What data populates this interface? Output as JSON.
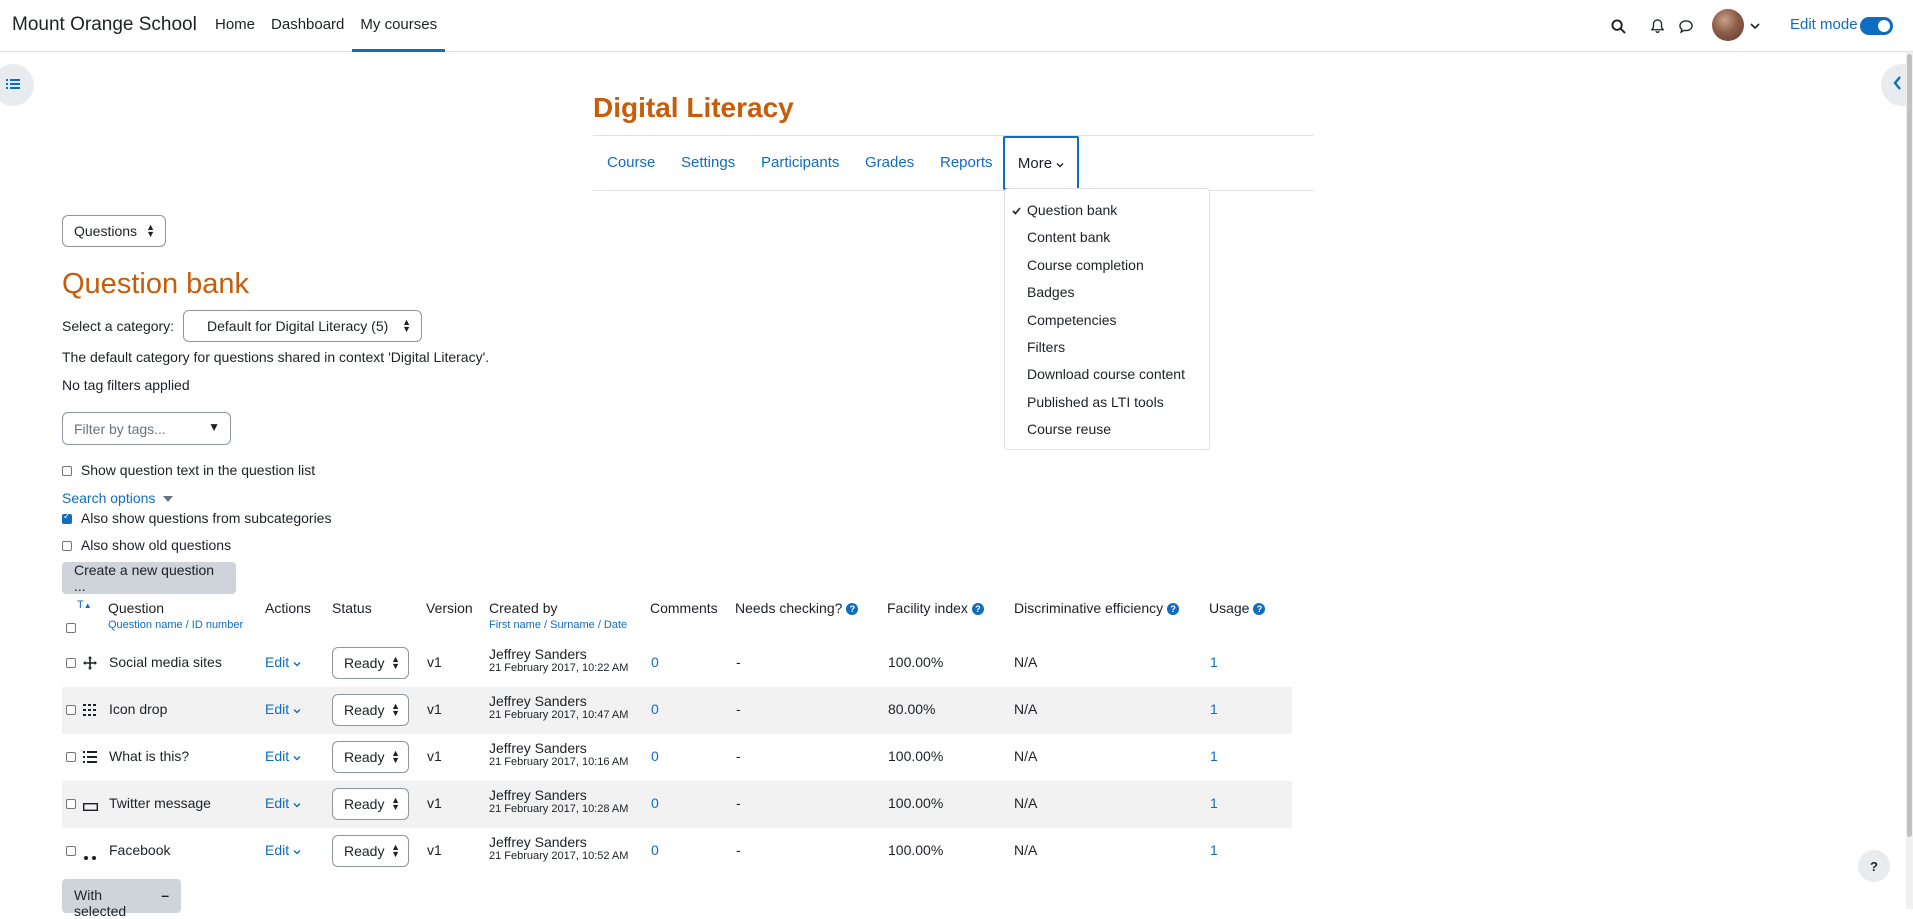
{
  "navbar": {
    "site_name": "Mount Orange School",
    "nav_items": [
      "Home",
      "Dashboard",
      "My courses"
    ],
    "active_nav": "My courses",
    "edit_mode_label": "Edit mode",
    "edit_mode_on": true
  },
  "course": {
    "title": "Digital Literacy",
    "tabs": [
      "Course",
      "Settings",
      "Participants",
      "Grades",
      "Reports"
    ],
    "more_label": "More",
    "more_menu": [
      {
        "label": "Question bank",
        "checked": true
      },
      {
        "label": "Content bank"
      },
      {
        "label": "Course completion"
      },
      {
        "label": "Badges"
      },
      {
        "label": "Competencies"
      },
      {
        "label": "Filters"
      },
      {
        "label": "Download course content"
      },
      {
        "label": "Published as LTI tools"
      },
      {
        "label": "Course reuse"
      }
    ]
  },
  "qbank": {
    "selector_value": "Questions",
    "title": "Question bank",
    "category_label": "Select a category:",
    "category_value": "Default for Digital Literacy (5)",
    "category_desc": "The default category for questions shared in context 'Digital Literacy'.",
    "tag_status": "No tag filters applied",
    "tag_filter_placeholder": "Filter by tags...",
    "show_text_label": "Show question text in the question list",
    "search_options_label": "Search options",
    "subcategories_label": "Also show questions from subcategories",
    "old_questions_label": "Also show old questions",
    "create_button": "Create a new question ...",
    "with_selected_button": "With selected"
  },
  "table": {
    "headers": {
      "type": "T",
      "question": "Question",
      "question_sub": "Question name / ID number",
      "actions": "Actions",
      "status": "Status",
      "version": "Version",
      "created_by": "Created by",
      "created_by_sub": "First name / Surname / Date",
      "comments": "Comments",
      "needs_checking": "Needs checking?",
      "facility": "Facility index",
      "discriminative": "Discriminative efficiency",
      "usage": "Usage"
    },
    "rows": [
      {
        "type_icon": "drag-drop-marker-icon",
        "name": "Social media sites",
        "action": "Edit",
        "status": "Ready",
        "version": "v1",
        "creator": "Jeffrey Sanders",
        "date": "21 February 2017, 10:22 AM",
        "comments": "0",
        "needs": "-",
        "facility": "100.00%",
        "disc": "N/A",
        "usage": "1"
      },
      {
        "type_icon": "drag-drop-grid-icon",
        "name": "Icon drop",
        "action": "Edit",
        "status": "Ready",
        "version": "v1",
        "creator": "Jeffrey Sanders",
        "date": "21 February 2017, 10:47 AM",
        "comments": "0",
        "needs": "-",
        "facility": "80.00%",
        "disc": "N/A",
        "usage": "1"
      },
      {
        "type_icon": "multichoice-list-icon",
        "name": "What is this?",
        "action": "Edit",
        "status": "Ready",
        "version": "v1",
        "creator": "Jeffrey Sanders",
        "date": "21 February 2017, 10:16 AM",
        "comments": "0",
        "needs": "-",
        "facility": "100.00%",
        "disc": "N/A",
        "usage": "1"
      },
      {
        "type_icon": "short-answer-icon",
        "name": "Twitter message",
        "action": "Edit",
        "status": "Ready",
        "version": "v1",
        "creator": "Jeffrey Sanders",
        "date": "21 February 2017, 10:28 AM",
        "comments": "0",
        "needs": "-",
        "facility": "100.00%",
        "disc": "N/A",
        "usage": "1"
      },
      {
        "type_icon": "gapselect-icon",
        "name": "Facebook",
        "action": "Edit",
        "status": "Ready",
        "version": "v1",
        "creator": "Jeffrey Sanders",
        "date": "21 February 2017, 10:52 AM",
        "comments": "0",
        "needs": "-",
        "facility": "100.00%",
        "disc": "N/A",
        "usage": "1"
      }
    ]
  },
  "colors": {
    "brand": "#0f6cbf",
    "heading": "#c65d0b"
  },
  "help_button": "?"
}
